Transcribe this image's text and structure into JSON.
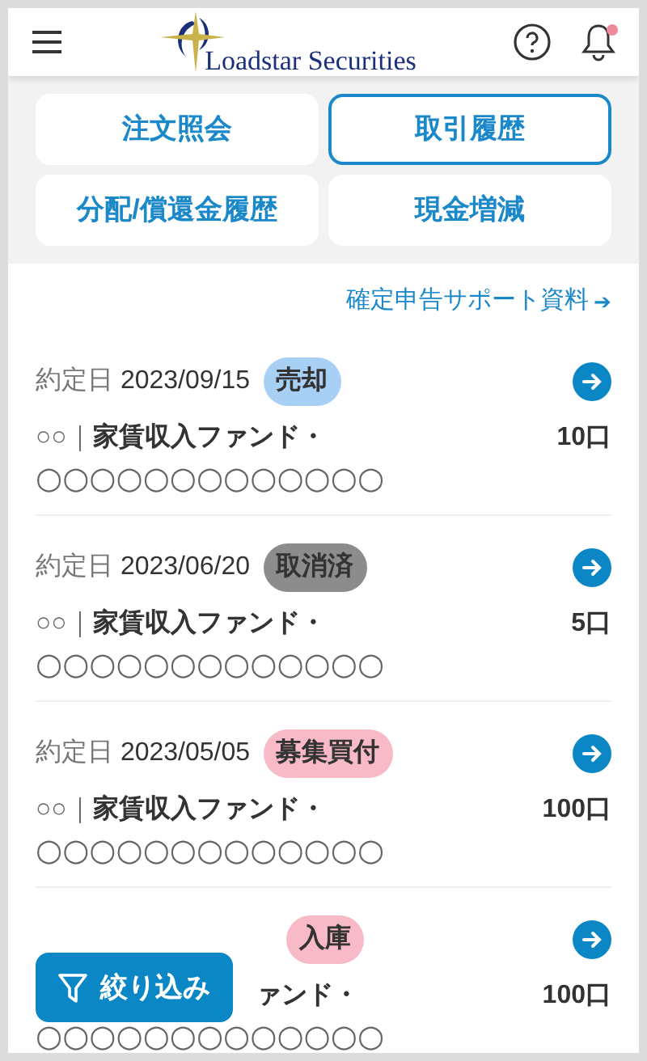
{
  "header": {
    "logo_text": "Loadstar Securities",
    "notification_dot": true
  },
  "tabs": [
    {
      "label": "注文照会",
      "selected": false
    },
    {
      "label": "取引履歴",
      "selected": true
    },
    {
      "label": "分配/償還金履歴",
      "selected": false
    },
    {
      "label": "現金増減",
      "selected": false
    }
  ],
  "support_link": {
    "label": "確定申告サポート資料",
    "arrow": "➔"
  },
  "items": [
    {
      "date_label": "約定日",
      "date": "2023/09/15",
      "badge": "売却",
      "color": "#a8d0f5",
      "prefix": "○○｜",
      "name": "家賃収入ファンド・",
      "name2": "○○○○○○○○○○○○○",
      "quantity": "10口"
    },
    {
      "date_label": "約定日",
      "date": "2023/06/20",
      "badge": "取消済",
      "color": "#8c8c8c",
      "prefix": "○○｜",
      "name": "家賃収入ファンド・",
      "name2": "○○○○○○○○○○○○○",
      "quantity": "5口"
    },
    {
      "date_label": "約定日",
      "date": "2023/05/05",
      "badge": "募集買付",
      "color": "#f8bac6",
      "prefix": "○○｜",
      "name": "家賃収入ファンド・",
      "name2": "○○○○○○○○○○○○○",
      "quantity": "100口"
    },
    {
      "badge": "入庫",
      "color": "#f8bac6",
      "name": "ァンド・",
      "name2": "○○○○○○○○○○○○○",
      "quantity": "100口"
    }
  ],
  "filter_button": {
    "label": "絞り込み"
  }
}
